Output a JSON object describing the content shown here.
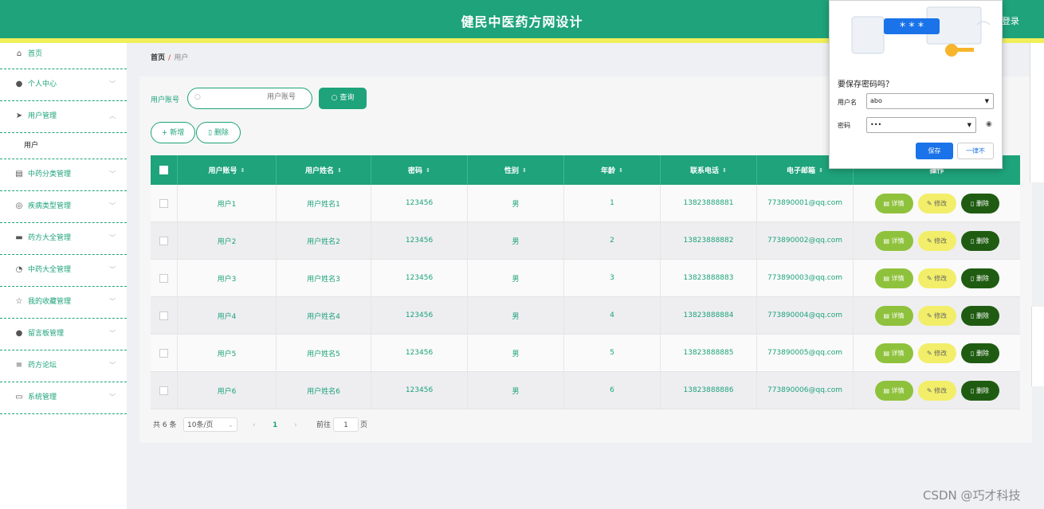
{
  "header": {
    "title": "健民中医药方网设计",
    "logout": "登录"
  },
  "sidebar": {
    "items": [
      {
        "label": "首页",
        "icon": "home-icon",
        "glyph": "⌂",
        "has_chevron": false
      },
      {
        "label": "个人中心",
        "icon": "user-icon",
        "glyph": "●",
        "has_chevron": true
      },
      {
        "label": "用户管理",
        "icon": "send-icon",
        "glyph": "➤",
        "has_chevron": true,
        "expanded": true,
        "sub": "用户"
      },
      {
        "label": "中药分类管理",
        "icon": "clipboard-icon",
        "glyph": "▤",
        "has_chevron": true
      },
      {
        "label": "疾病类型管理",
        "icon": "globe-icon",
        "glyph": "◎",
        "has_chevron": true
      },
      {
        "label": "药方大全管理",
        "icon": "chat-icon",
        "glyph": "▬",
        "has_chevron": true
      },
      {
        "label": "中药大全管理",
        "icon": "compass-icon",
        "glyph": "◔",
        "has_chevron": true
      },
      {
        "label": "我的收藏管理",
        "icon": "star-icon",
        "glyph": "☆",
        "has_chevron": true
      },
      {
        "label": "留言板管理",
        "icon": "user-icon",
        "glyph": "●",
        "has_chevron": true
      },
      {
        "label": "药方论坛",
        "icon": "menu-icon",
        "glyph": "≡",
        "has_chevron": true
      },
      {
        "label": "系统管理",
        "icon": "card-icon",
        "glyph": "▭",
        "has_chevron": true
      }
    ]
  },
  "breadcrumb": {
    "home": "首页",
    "sep": "/",
    "current": "用户"
  },
  "search": {
    "label": "用户账号",
    "placeholder": "用户账号",
    "query_button": "查询"
  },
  "actions": {
    "add": "新增",
    "delete": "删除"
  },
  "table": {
    "headers": [
      "用户账号",
      "用户姓名",
      "密码",
      "性别",
      "年龄",
      "联系电话",
      "电子邮箱",
      "操作"
    ],
    "row_actions": {
      "detail": "详情",
      "edit": "修改",
      "delete": "删除"
    },
    "rows": [
      [
        "用户1",
        "用户姓名1",
        "123456",
        "男",
        "1",
        "13823888881",
        "773890001@qq.com"
      ],
      [
        "用户2",
        "用户姓名2",
        "123456",
        "男",
        "2",
        "13823888882",
        "773890002@qq.com"
      ],
      [
        "用户3",
        "用户姓名3",
        "123456",
        "男",
        "3",
        "13823888883",
        "773890003@qq.com"
      ],
      [
        "用户4",
        "用户姓名4",
        "123456",
        "男",
        "4",
        "13823888884",
        "773890004@qq.com"
      ],
      [
        "用户5",
        "用户姓名5",
        "123456",
        "男",
        "5",
        "13823888885",
        "773890005@qq.com"
      ],
      [
        "用户6",
        "用户姓名6",
        "123456",
        "男",
        "6",
        "13823888886",
        "773890006@qq.com"
      ]
    ]
  },
  "pagination": {
    "total": "共 6 条",
    "page_size": "10条/页",
    "current_page": "1",
    "goto_label": "前往",
    "goto_value": "1",
    "page_suffix": "页"
  },
  "password_popup": {
    "title": "要保存密码吗？",
    "username_label": "用户名",
    "username_value": "abo",
    "password_label": "密码",
    "password_value": "•••",
    "save": "保存",
    "never": "一律不",
    "illustration_text": "* * *"
  },
  "watermark": "CSDN @巧才科技",
  "colors": {
    "primary": "#1ea37a",
    "accent": "#f0ef5a",
    "detail": "#8fc23c",
    "edit": "#f2ee69",
    "delete": "#1f5c12",
    "chrome_blue": "#1a73e8"
  }
}
